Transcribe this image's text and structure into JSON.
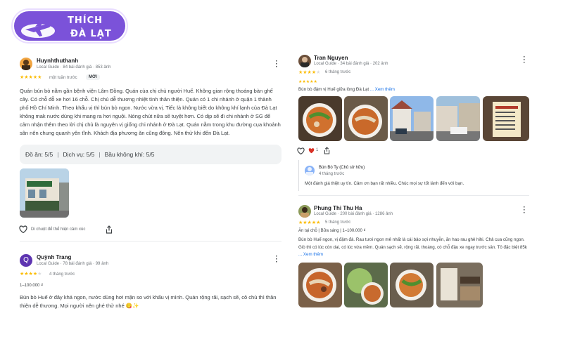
{
  "logo": {
    "line1": "THÍCH",
    "line2": "ĐÀ LẠT"
  },
  "review1": {
    "name": "Huynhthuthanh",
    "meta": "Local Guide · 84 bài đánh giá · 853 ảnh",
    "rating": 5,
    "time": "một tuần trước",
    "badge": "MỚI",
    "text": "Quán bún bò nằm gần bệnh viện Lâm Đồng. Quán của chị chủ người Huế. Không gian rộng thoáng bàn ghế cây. Có chỗ đỗ xe hơi 16 chỗ. Chị chủ dễ thương nhiệt tình thân thiện. Quán có 1 chi nhánh ở quận 1 thành phố Hồ Chí Minh. Theo khẩu vị thì bún bò ngon. Nước vừa vị. Tiếc là không biết do không khí lạnh của Đà Lạt không mak nước dùng khi mang ra hơi nguội. Nóng chút nữa sẽ tuyệt hơn. Có dịp sẽ đi chi nhánh ở SG để cảm nhận thêm theo lời chị chủ là nguyên vị giống chi nhánh ở Đà Lạt. Quán nằm trong khu đường cụa khoảnh sân nên chung quanh yên tĩnh. Khách địa phương ăn cũng đông. Nên thử khi đến Đà Lạt.",
    "food": "Đồ ăn: 5/5",
    "service": "Dịch vụ: 5/5",
    "atmosphere": "Bầu không khí: 5/5",
    "hover_text": "Di chuột để thể hiện cảm xúc"
  },
  "review2": {
    "avatar_letter": "Q",
    "name": "Quỳnh Trang",
    "meta": "Local Guide · 78 bài đánh giá · 99 ảnh",
    "rating": 4,
    "time": "4 tháng trước",
    "price": "1–100.000 ₫",
    "text": "Bún bò Huế ở đây khá ngon, nước dùng hơi mặn so với khẩu vị mình. Quán rộng rãi, sạch sẽ, cô chủ thì thân thiện dễ thương. Mọi người nên ghé thử nhé 😋✨"
  },
  "review3": {
    "name": "Tran Nguyen",
    "meta": "Local Guide · 34 bài đánh giá · 202 ảnh",
    "rating": 4,
    "time": "6 tháng trước",
    "text": "Bún bò đậm vị Huế giữa lòng Đà Lạt",
    "more": "... Xem thêm",
    "like_count": "1",
    "owner_name": "Bún Bò Ty (Chủ sở hữu)",
    "owner_time": "4 tháng trước",
    "owner_text": "Một đánh giá thiệt uy tín. Cảm ơn bạn rất nhiều. Chúc mọi sự tốt lành đến với bạn."
  },
  "review4": {
    "name": "Phung Thi Thu Ha",
    "meta": "Local Guide · 200 bài đánh giá · 1286 ảnh",
    "rating": 5,
    "time": "5 tháng trước",
    "tags": "Ăn tại chỗ | Bữa sáng | 1–100.000 ₫",
    "text": "Bún bò Huế ngon, vị đậm đà. Rau tươi ngon mê nhất là cái bảo sợi nhuyễn, ăn hao rau ghê hihi. Chả cua cũng ngon. Giò thì có lúc còn dai, có lúc vừa mềm. Quán sạch sẽ, rộng rãi, thoáng, có chỗ đậu xe ngay trước sân. Tô đặc biệt 85k",
    "more": "... Xem thêm"
  },
  "colors": {
    "brand": "#7b52d9",
    "star": "#fbbc04",
    "link": "#1a73e8"
  }
}
